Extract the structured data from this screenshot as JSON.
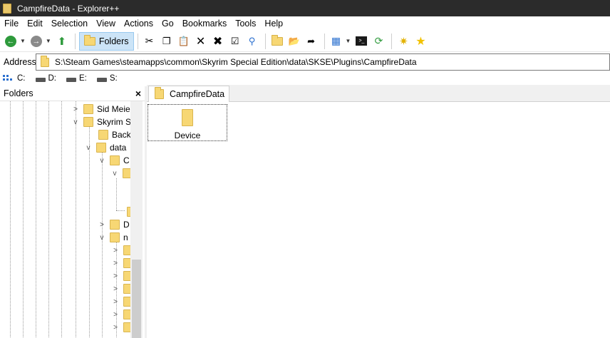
{
  "window": {
    "title": "CampfireData - Explorer++"
  },
  "menu": {
    "items": [
      "File",
      "Edit",
      "Selection",
      "View",
      "Actions",
      "Go",
      "Bookmarks",
      "Tools",
      "Help"
    ]
  },
  "toolbar": {
    "folders_label": "Folders"
  },
  "address": {
    "label": "Address",
    "path": "S:\\Steam Games\\steamapps\\common\\Skyrim Special Edition\\data\\SKSE\\Plugins\\CampfireData"
  },
  "drives": [
    "C:",
    "D:",
    "E:",
    "S:"
  ],
  "folders_pane": {
    "title": "Folders",
    "close": "×",
    "nodes": [
      {
        "label": "Sid Meie",
        "chevron": ">"
      },
      {
        "label": "Skyrim S",
        "chevron": "v"
      },
      {
        "label": "Back",
        "chevron": ""
      },
      {
        "label": "data",
        "chevron": "v"
      },
      {
        "label": "C",
        "chevron": "v"
      },
      {
        "label": "",
        "chevron": "v"
      },
      {
        "label": "",
        "chevron": ""
      },
      {
        "label": "D",
        "chevron": ">"
      },
      {
        "label": "n",
        "chevron": "v"
      }
    ]
  },
  "tabs": [
    {
      "label": "CampfireData"
    }
  ],
  "files": [
    {
      "name": "Device"
    }
  ],
  "colors": {
    "titlebar": "#2b2b2b",
    "folder": "#f7d774",
    "selected_button": "#cce4f7"
  }
}
